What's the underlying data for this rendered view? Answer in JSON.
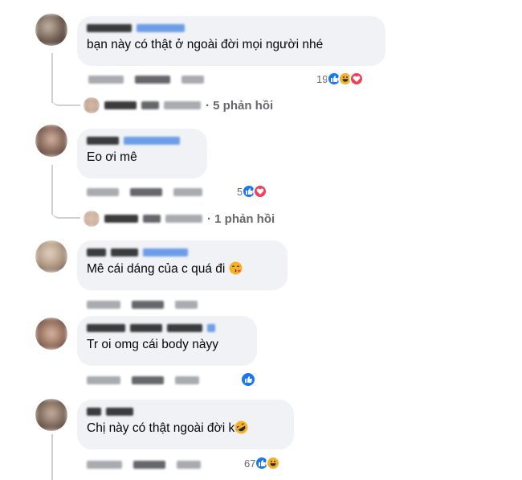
{
  "comments": [
    {
      "text": "bạn này có thật ở ngoài đời mọi người nhé",
      "reaction_count": "19",
      "reactions": [
        "like-icon",
        "haha-icon",
        "love-icon"
      ],
      "replies_label": "· 5 phản hồi"
    },
    {
      "text": "Eo ơi mê",
      "reaction_count": "5",
      "reactions": [
        "like-icon",
        "love-icon"
      ],
      "replies_label": "· 1 phản hồi"
    },
    {
      "text": "Mê cái dáng của c quá đi",
      "reactions": []
    },
    {
      "text": "Tr oi omg cái body nàyy",
      "reactions": [
        "like-icon"
      ]
    },
    {
      "text": "Chị này có thật ngoài đời k",
      "reaction_count": "67",
      "reactions": [
        "like-icon",
        "haha-icon"
      ]
    }
  ],
  "colors": {
    "bubble": "#f0f2f5",
    "thread_line": "#ced0d4",
    "meta_text": "#65676b",
    "like": "#1877f2",
    "haha": "#f7b125",
    "love": "#f33e58"
  }
}
